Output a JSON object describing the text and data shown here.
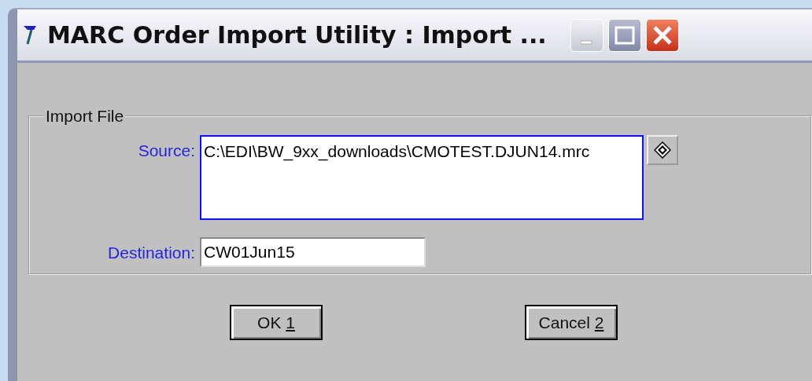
{
  "window": {
    "title": "MARC Order Import Utility : Import ..."
  },
  "group": {
    "legend": "Import File",
    "fields": [
      {
        "label": "Source:",
        "value": "C:\\EDI\\BW_9xx_downloads\\CMOTEST.DJUN14.mrc",
        "kind": "multiline",
        "focused": true
      },
      {
        "label": "Destination:",
        "value": "CW01Jun15",
        "kind": "single",
        "focused": false
      }
    ]
  },
  "buttons": [
    {
      "label": "OK",
      "shortcut": "1"
    },
    {
      "label": "Cancel",
      "shortcut": "2"
    }
  ]
}
